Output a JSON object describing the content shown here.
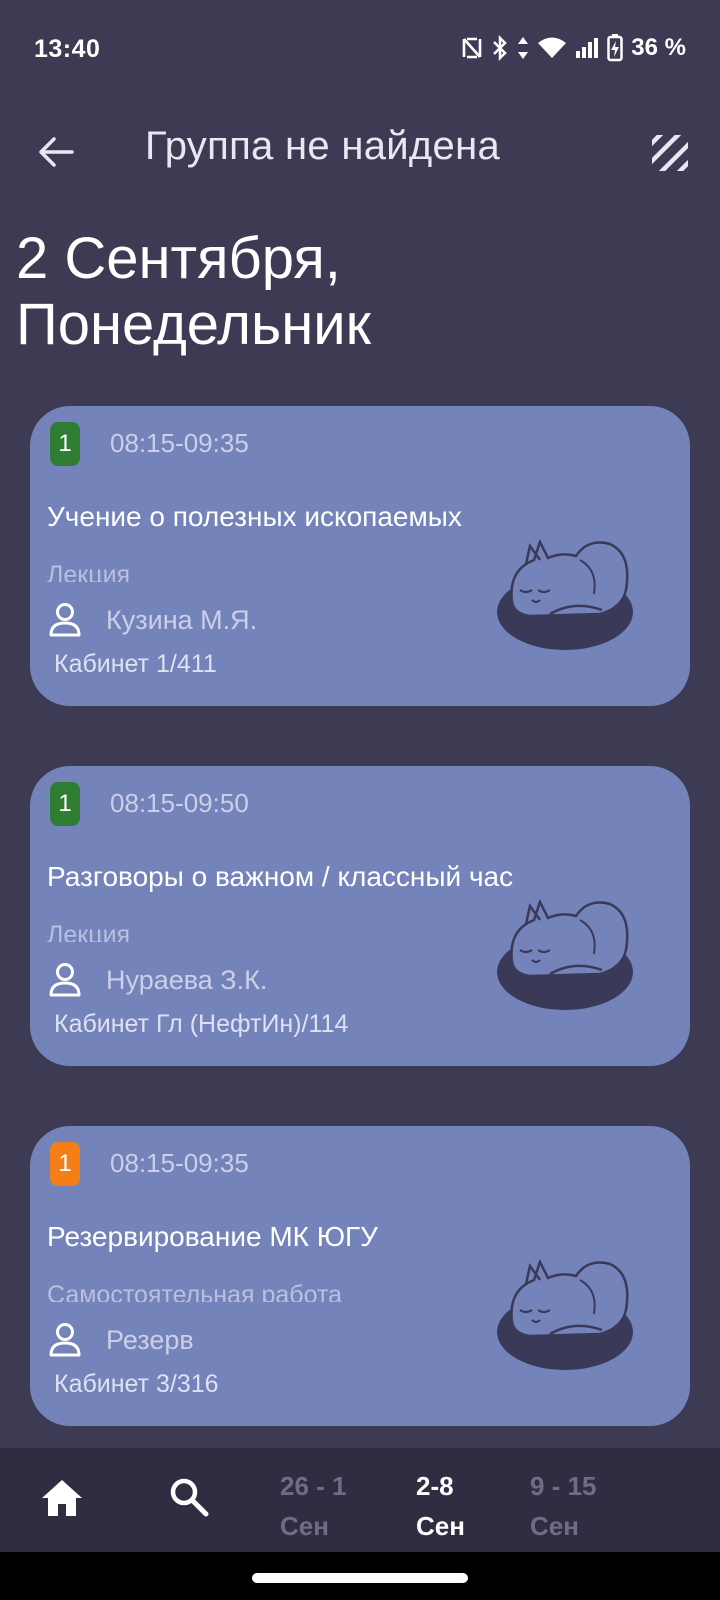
{
  "status_bar": {
    "time": "13:40",
    "battery_percent": "36 %",
    "icons": [
      "nfc-icon",
      "bluetooth-icon",
      "data-arrows-icon",
      "wifi-icon",
      "signal-icon",
      "battery-charging-icon"
    ]
  },
  "app_bar": {
    "title": "Группа не найдена",
    "back_icon": "arrow-left-icon",
    "menu_icon": "striped-square-icon"
  },
  "date_heading": {
    "line1": "2 Сентября,",
    "line2": "Понедельник"
  },
  "lessons": [
    {
      "number": "1",
      "badge_color": "#2e7d32",
      "time": "08:15-09:35",
      "subject": "Учение о полезных ископаемых",
      "type": "Лекция",
      "teacher": "Кузина М.Я.",
      "room": "Кабинет 1/411"
    },
    {
      "number": "1",
      "badge_color": "#2e7d32",
      "time": "08:15-09:50",
      "subject": "Разговоры о важном / классный час",
      "type": "Лекция",
      "teacher": "Нураева З.К.",
      "room": "Кабинет Гл (НефтИн)/114"
    },
    {
      "number": "1",
      "badge_color": "#f57f17",
      "time": "08:15-09:35",
      "subject": "Резервирование МК ЮГУ",
      "type": "Самостоятельная работа",
      "teacher": "Резерв",
      "room": "Кабинет 3/316"
    }
  ],
  "bottom_nav": {
    "home_icon": "home-icon",
    "search_icon": "search-icon",
    "weeks": [
      {
        "range": "26 - 1",
        "month": "Сен",
        "active": false
      },
      {
        "range": "2-8",
        "month": "Сен",
        "active": true
      },
      {
        "range": "9 - 15",
        "month": "Сен",
        "active": false
      }
    ]
  },
  "colors": {
    "background": "#3d3b53",
    "card": "#7483ba",
    "nav": "#2f2d42"
  }
}
